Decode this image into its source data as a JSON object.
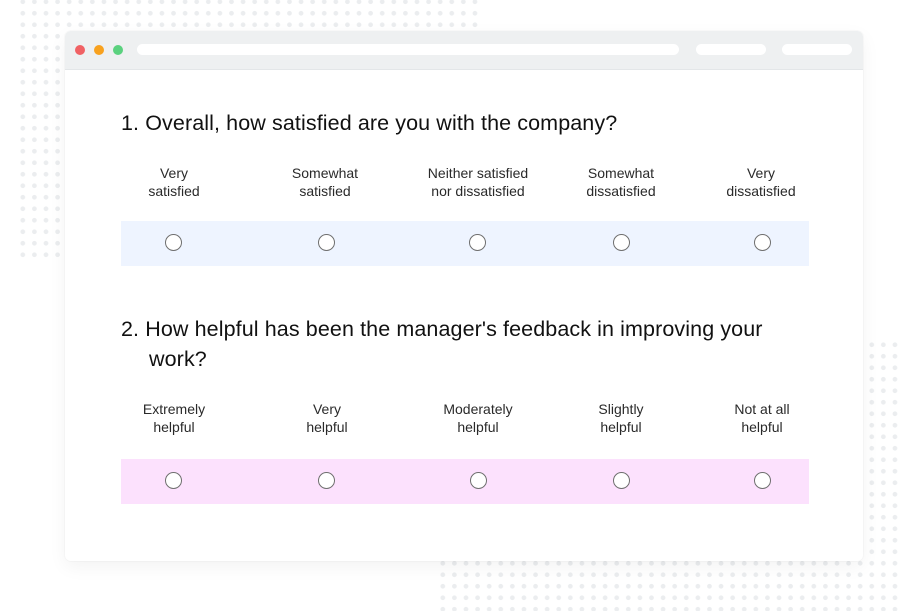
{
  "window": {
    "traffic_lights": [
      {
        "name": "close",
        "color": "#f06164"
      },
      {
        "name": "minimize",
        "color": "#f8a11e"
      },
      {
        "name": "maximize",
        "color": "#5ad17e"
      }
    ]
  },
  "questions": [
    {
      "number": "1.",
      "text": "Overall, how satisfied are you with the company?",
      "row_color": "#eef4ff",
      "options": [
        {
          "line1": "Very",
          "line2": "satisfied",
          "selected": false
        },
        {
          "line1": "Somewhat",
          "line2": "satisfied",
          "selected": false
        },
        {
          "line1": "Neither satisfied",
          "line2": "nor dissatisfied",
          "selected": false
        },
        {
          "line1": "Somewhat",
          "line2": "dissatisfied",
          "selected": false
        },
        {
          "line1": "Very",
          "line2": "dissatisfied",
          "selected": false
        }
      ]
    },
    {
      "number": "2.",
      "text": "How helpful has been the manager's feedback in improving your work?",
      "row_color": "#fce1fd",
      "options": [
        {
          "line1": "Extremely",
          "line2": "helpful",
          "selected": false
        },
        {
          "line1": "Very",
          "line2": "helpful",
          "selected": false
        },
        {
          "line1": "Moderately",
          "line2": "helpful",
          "selected": false
        },
        {
          "line1": "Slightly",
          "line2": "helpful",
          "selected": false
        },
        {
          "line1": "Not at all",
          "line2": "helpful",
          "selected": false
        }
      ]
    }
  ]
}
